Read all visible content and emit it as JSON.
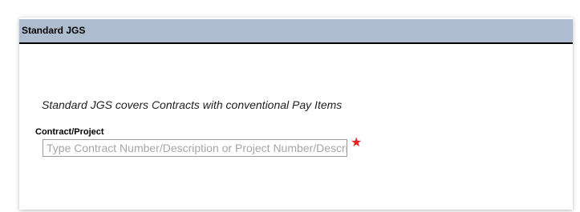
{
  "section": {
    "title": "Standard JGS",
    "description": "Standard JGS covers Contracts with conventional Pay Items"
  },
  "contract_field": {
    "label": "Contract/Project",
    "value": "",
    "placeholder": "Type Contract Number/Description or Project Number/Description",
    "required_marker": "★",
    "required_color": "#e8221b"
  },
  "colors": {
    "header_background": "#aebcd0",
    "header_rule": "#000000"
  },
  "icons": {
    "required": "required-star-icon"
  }
}
